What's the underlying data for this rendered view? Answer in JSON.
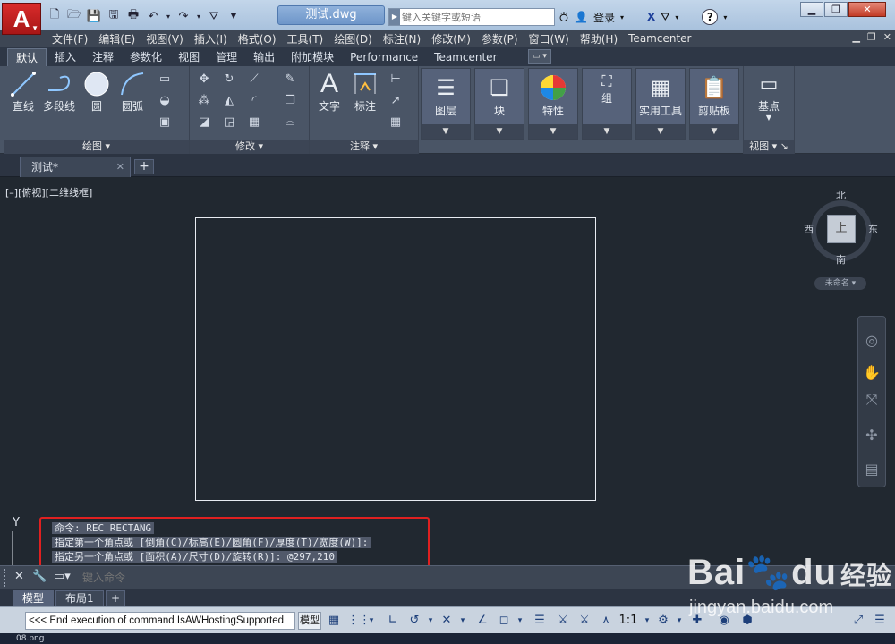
{
  "title_bar": {
    "logo_letter": "A",
    "document_title": "测试.dwg",
    "search_placeholder": "键入关键字或短语",
    "login_label": "登录",
    "help_label": "?"
  },
  "menu": {
    "items": [
      "文件(F)",
      "编辑(E)",
      "视图(V)",
      "插入(I)",
      "格式(O)",
      "工具(T)",
      "绘图(D)",
      "标注(N)",
      "修改(M)",
      "参数(P)",
      "窗口(W)",
      "帮助(H)",
      "Teamcenter"
    ]
  },
  "ribbon": {
    "tabs": [
      "默认",
      "插入",
      "注释",
      "参数化",
      "视图",
      "管理",
      "输出",
      "附加模块",
      "Performance",
      "Teamcenter"
    ],
    "active_tab": "默认",
    "draw_panel": {
      "title": "绘图",
      "tools": [
        "直线",
        "多段线",
        "圆",
        "圆弧"
      ]
    },
    "modify_panel": {
      "title": "修改"
    },
    "annotate_panel": {
      "title": "注释",
      "tools": [
        "文字",
        "标注"
      ]
    },
    "big_buttons": [
      "图层",
      "块",
      "特性",
      "组",
      "实用工具",
      "剪贴板"
    ],
    "view_panel": {
      "title": "视图",
      "tool": "基点"
    }
  },
  "file_tabs": {
    "active": "测试*"
  },
  "drawing": {
    "view_label": "[–][俯视][二维线框]",
    "viewcube": {
      "north": "北",
      "south": "南",
      "east": "东",
      "west": "西",
      "face": "上",
      "ucs_name": "未命名"
    },
    "ucs_label": "Y"
  },
  "command_history": [
    "命令: REC RECTANG",
    "指定第一个角点或 [倒角(C)/标高(E)/圆角(F)/厚度(T)/宽度(W)]:",
    "指定另一个角点或 [面积(A)/尺寸(D)/旋转(R)]: @297,210"
  ],
  "command_line": {
    "placeholder": "键入命令"
  },
  "layout_tabs": [
    "模型",
    "布局1"
  ],
  "status_bar": {
    "message": "<<< End execution of command IsAWHostingSupported",
    "model_label": "模型",
    "scale": "1:1"
  },
  "taskbar_text": "08.png",
  "watermark": {
    "logo": "Bai",
    "logo_du": "du",
    "logo_suffix": "经验",
    "url": "jingyan.baidu.com"
  },
  "colors": {
    "accent_red": "#d92b2b",
    "highlight_border": "#e02020",
    "canvas": "#212830"
  }
}
